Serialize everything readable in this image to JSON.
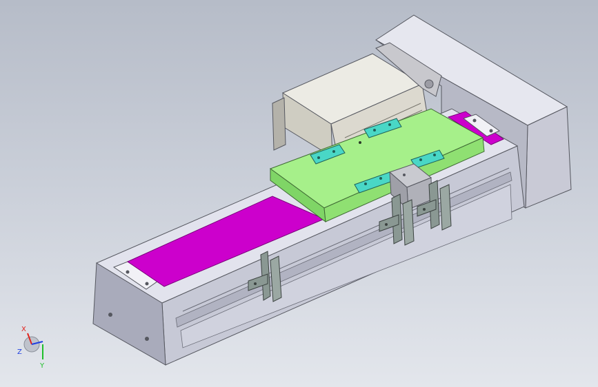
{
  "viewport": {
    "colors": {
      "background_top": "#b6bcc8",
      "background_bottom": "#e3e6ec",
      "base": "#dadce9",
      "base_shadow": "#a9abbb",
      "belt": "#cc00cc",
      "carriage": "#a6f08a",
      "carriage_side": "#7fd566",
      "clamp": "#49d7c6",
      "bracket": "#8a9893",
      "motor": "#dcd9cf"
    }
  },
  "model": {
    "name": "linear-module-assembly",
    "parts": [
      "aluminum-base",
      "timing-belt",
      "carriage-plate",
      "stepper-motor",
      "end-housing",
      "sensor-brackets",
      "clamp-blocks"
    ]
  },
  "triad": {
    "icon": "axis-triad-icon",
    "x_label": "X",
    "y_label": "Y",
    "z_label": "Z",
    "x_color": "#e0201a",
    "y_color": "#1fbf2a",
    "z_color": "#2040e0"
  }
}
